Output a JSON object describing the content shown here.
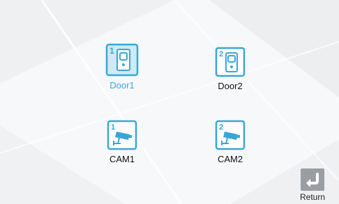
{
  "screen": {
    "tiles": [
      {
        "label": "Door1",
        "index": "1",
        "kind": "door",
        "selected": true
      },
      {
        "label": "Door2",
        "index": "2",
        "kind": "door",
        "selected": false
      },
      {
        "label": "CAM1",
        "index": "1",
        "kind": "camera",
        "selected": false
      },
      {
        "label": "CAM2",
        "index": "2",
        "kind": "camera",
        "selected": false
      }
    ],
    "return_label": "Return",
    "colors": {
      "accent": "#3aa6d6",
      "selected_fill": "#cfe9f6",
      "return_bg": "#9b9ea1"
    }
  }
}
